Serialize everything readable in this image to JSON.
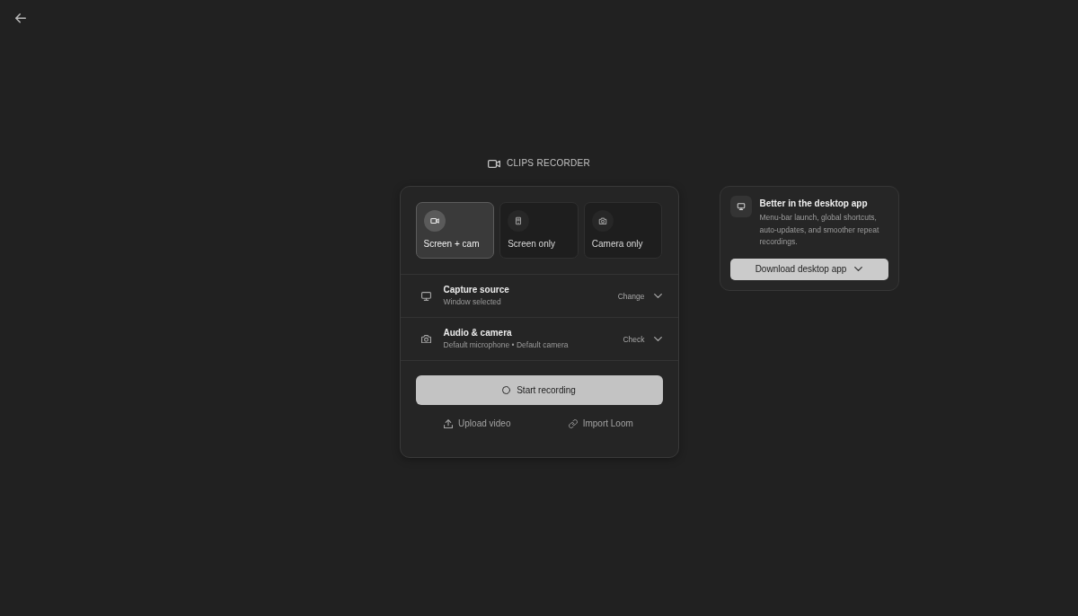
{
  "header": {
    "title": "CLIPS RECORDER"
  },
  "modes": [
    {
      "label": "Screen + cam",
      "selected": true
    },
    {
      "label": "Screen only",
      "selected": false
    },
    {
      "label": "Camera only",
      "selected": false
    }
  ],
  "settings": [
    {
      "title": "Capture source",
      "subtitle": "Window selected",
      "action": "Change"
    },
    {
      "title": "Audio & camera",
      "subtitle": "Default microphone • Default camera",
      "action": "Check"
    }
  ],
  "primary_button": {
    "label": "Start recording"
  },
  "links": [
    {
      "label": "Upload video"
    },
    {
      "label": "Import Loom"
    }
  ],
  "promo": {
    "title": "Better in the desktop app",
    "description": "Menu-bar launch, global shortcuts, auto-updates, and smoother repeat recordings.",
    "button": "Download desktop app"
  }
}
